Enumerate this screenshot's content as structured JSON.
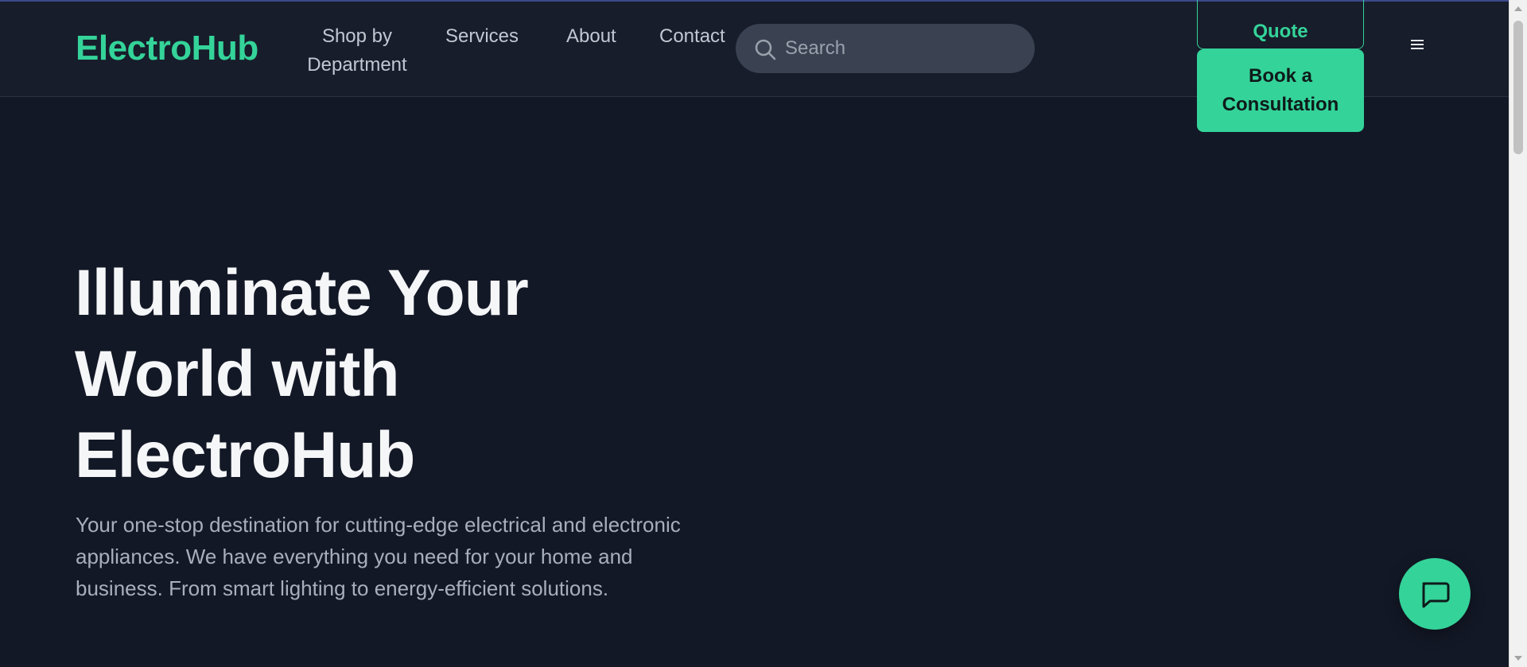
{
  "header": {
    "logo": "ElectroHub",
    "nav": [
      "Shop by Department",
      "Services",
      "About",
      "Contact"
    ],
    "search": {
      "placeholder": "Search"
    },
    "quote_button": "Quote",
    "consult_button": "Book a Consultation",
    "menu_icon": "hamburger-icon"
  },
  "hero": {
    "title": "Illuminate Your World with ElectroHub",
    "description": "Your one-stop destination for cutting-edge electrical and electronic appliances. We have everything you need for your home and business. From smart lighting to energy-efficient solutions."
  },
  "chat": {
    "icon": "chat-bubble-icon"
  },
  "colors": {
    "accent": "#34d399",
    "background": "#131826",
    "header": "#171d2b",
    "search_bg": "#3a4150"
  }
}
